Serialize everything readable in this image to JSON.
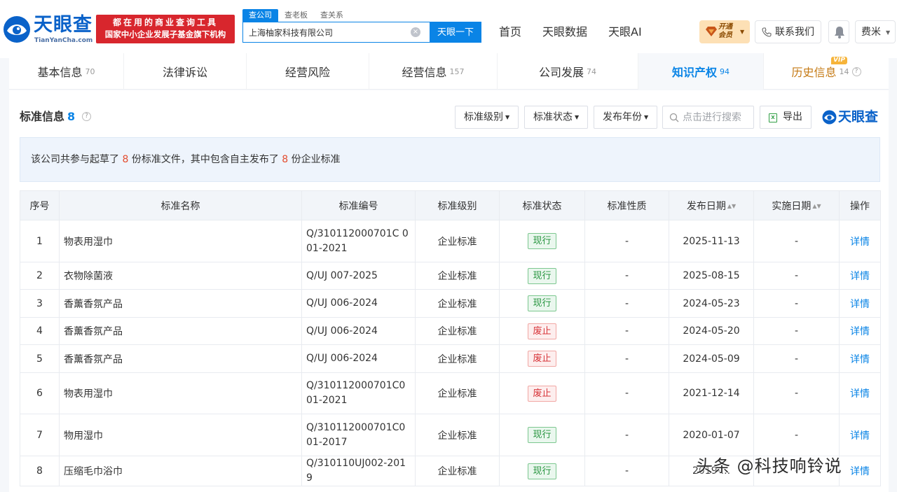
{
  "header": {
    "logo_cn": "天眼查",
    "logo_en": "TianYanCha.com",
    "promo_line1": "都在用的商业查询工具",
    "promo_line2": "国家中小企业发展子基金旗下机构",
    "search_tabs": [
      "查公司",
      "查老板",
      "查关系"
    ],
    "search_value": "上海柚家科技有限公司",
    "search_button": "天眼一下",
    "nav": [
      "首页",
      "天眼数据",
      "天眼AI"
    ],
    "vip_line1": "开通",
    "vip_line2": "会员",
    "contact": "联系我们",
    "user": "费米"
  },
  "tabs": [
    {
      "label": "基本信息",
      "count": "70"
    },
    {
      "label": "法律诉讼",
      "count": ""
    },
    {
      "label": "经营风险",
      "count": ""
    },
    {
      "label": "经营信息",
      "count": "157"
    },
    {
      "label": "公司发展",
      "count": "74"
    },
    {
      "label": "知识产权",
      "count": "94"
    },
    {
      "label": "历史信息",
      "count": "14",
      "badge": "VIP"
    }
  ],
  "section": {
    "title": "标准信息",
    "count": "8",
    "filters": [
      "标准级别",
      "标准状态",
      "发布年份"
    ],
    "search_placeholder": "点击进行搜索",
    "export": "导出",
    "brand": "天眼查"
  },
  "notice": {
    "prefix": "该公司共参与起草了",
    "num1": "8",
    "mid": "份标准文件，其中包含自主发布了",
    "num2": "8",
    "suffix": "份企业标准"
  },
  "table": {
    "headers": [
      "序号",
      "标准名称",
      "标准编号",
      "标准级别",
      "标准状态",
      "标准性质",
      "发布日期",
      "实施日期",
      "操作"
    ],
    "rows": [
      {
        "no": "1",
        "name": "物表用湿巾",
        "code": "Q/310112000701C 001-2021",
        "level": "企业标准",
        "status": "现行",
        "status_type": "active",
        "nature": "-",
        "pub": "2025-11-13",
        "impl": "-",
        "op": "详情"
      },
      {
        "no": "2",
        "name": "衣物除菌液",
        "code": "Q/UJ 007-2025",
        "level": "企业标准",
        "status": "现行",
        "status_type": "active",
        "nature": "-",
        "pub": "2025-08-15",
        "impl": "-",
        "op": "详情"
      },
      {
        "no": "3",
        "name": "香薰香氛产品",
        "code": "Q/UJ 006-2024",
        "level": "企业标准",
        "status": "现行",
        "status_type": "active",
        "nature": "-",
        "pub": "2024-05-23",
        "impl": "-",
        "op": "详情"
      },
      {
        "no": "4",
        "name": "香薰香氛产品",
        "code": "Q/UJ 006-2024",
        "level": "企业标准",
        "status": "废止",
        "status_type": "void",
        "nature": "-",
        "pub": "2024-05-20",
        "impl": "-",
        "op": "详情"
      },
      {
        "no": "5",
        "name": "香薰香氛产品",
        "code": "Q/UJ 006-2024",
        "level": "企业标准",
        "status": "废止",
        "status_type": "void",
        "nature": "-",
        "pub": "2024-05-09",
        "impl": "-",
        "op": "详情"
      },
      {
        "no": "6",
        "name": "物表用湿巾",
        "code": "Q/310112000701C001-2021",
        "level": "企业标准",
        "status": "废止",
        "status_type": "void",
        "nature": "-",
        "pub": "2021-12-14",
        "impl": "-",
        "op": "详情"
      },
      {
        "no": "7",
        "name": "物用湿巾",
        "code": "Q/310112000701C001-2017",
        "level": "企业标准",
        "status": "现行",
        "status_type": "active",
        "nature": "-",
        "pub": "2020-01-07",
        "impl": "-",
        "op": "详情"
      },
      {
        "no": "8",
        "name": "压缩毛巾浴巾",
        "code": "Q/310110UJ002-2019",
        "level": "企业标准",
        "status": "现行",
        "status_type": "active",
        "nature": "-",
        "pub": "2019-...",
        "impl": "-",
        "op": "详情"
      }
    ]
  },
  "watermark": "头条 @科技响铃说",
  "colors": {
    "brand_blue": "#0a84e6",
    "promo_red": "#d8262d",
    "active_green": "#27953f",
    "void_red": "#d8353a",
    "highlight_num": "#e34d2f"
  }
}
